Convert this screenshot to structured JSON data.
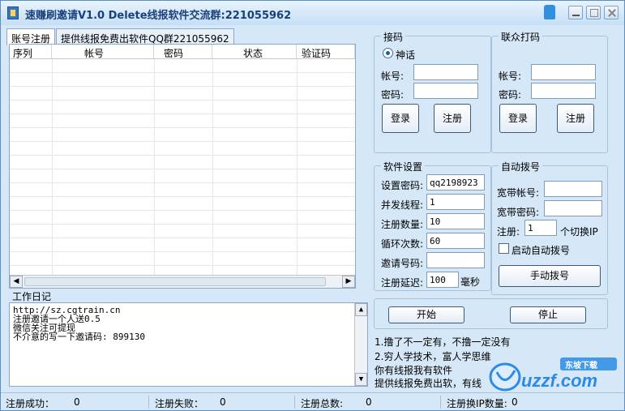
{
  "window": {
    "title": "速赚刷邀请V1.0  Delete线报软件交流群:221055962"
  },
  "tabs": [
    {
      "label": "账号注册",
      "active": true
    },
    {
      "label": "提供线报免费出软件QQ群221055962",
      "active": false
    }
  ],
  "grid": {
    "columns": [
      "序列",
      "帐号",
      "密码",
      "状态",
      "验证码"
    ]
  },
  "log": {
    "title": "工作日记",
    "lines": [
      "http://sz.cgtrain.cn",
      "注册邀请一个人送0.5",
      "微信关注可提现",
      "不介意的写一下邀请码: 899130"
    ]
  },
  "jiema": {
    "title": "接码",
    "radio_label": "神话",
    "account_label": "帐号:",
    "password_label": "密码:",
    "account_value": "",
    "password_value": "",
    "login_label": "登录",
    "register_label": "注册"
  },
  "lianzhong": {
    "title": "联众打码",
    "account_label": "帐号:",
    "password_label": "密码:",
    "account_value": "",
    "password_value": "",
    "login_label": "登录",
    "register_label": "注册"
  },
  "software": {
    "title": "软件设置",
    "set_password_label": "设置密码:",
    "set_password_value": "qq2198923",
    "threads_label": "并发线程:",
    "threads_value": "1",
    "register_count_label": "注册数量:",
    "register_count_value": "10",
    "loop_count_label": "循环次数:",
    "loop_count_value": "60",
    "invite_code_label": "邀请号码:",
    "invite_code_value": "",
    "delay_label": "注册延迟:",
    "delay_value": "100",
    "delay_unit": "毫秒"
  },
  "dialup": {
    "title": "自动拨号",
    "broadband_account_label": "宽带帐号:",
    "broadband_password_label": "宽带密码:",
    "broadband_account_value": "",
    "broadband_password_value": "",
    "register_label": "注册:",
    "per_switch_value": "1",
    "per_switch_suffix": "个切换IP",
    "auto_dial_label": "启动自动拨号",
    "manual_dial_label": "手动拨号"
  },
  "actions": {
    "start_label": "开始",
    "stop_label": "停止"
  },
  "notes": [
    "1.撸了不一定有，不撸一定没有",
    "2.穷人学技术，富人学思维",
    "你有线报我有软件",
    "提供线报免费出软，有线"
  ],
  "statusbar": {
    "success_label": "注册成功：",
    "success_value": "0",
    "fail_label": "注册失败：",
    "fail_value": "0",
    "total_label": "注册总数:",
    "total_value": "0",
    "switch_label": "注册换IP数量:",
    "switch_value": "0"
  },
  "watermark": {
    "brand": "uzzf.com",
    "sub": "东坡下载"
  },
  "colors": {
    "window_bg": "#d6e8f8",
    "title_text": "#1a3f7a",
    "border": "#8aa9c8"
  }
}
